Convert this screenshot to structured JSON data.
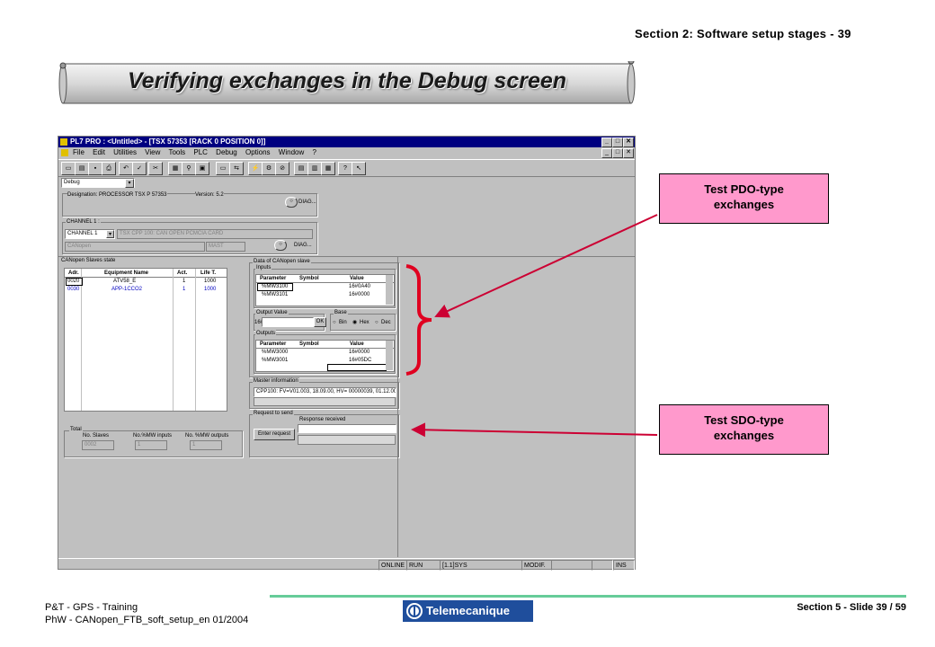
{
  "slide_header": "Section 2: Software setup stages - 39",
  "banner_title": "Verifying exchanges in the Debug screen",
  "app": {
    "title": "PL7 PRO : <Untitled> - [TSX 57353 [RACK 0     POSITION 0]]",
    "menu": [
      "File",
      "Edit",
      "Utilities",
      "View",
      "Tools",
      "PLC",
      "Debug",
      "Options",
      "Window",
      "?"
    ],
    "mode_select": "Debug",
    "designation": "Designation: PROCESSOR TSX P 57353",
    "version": "Version: 5.2",
    "diag_label": "DIAG...",
    "channel_group": "CHANNEL 1 :",
    "channel_select": "CHANNEL 1",
    "card_select": "TSX CPP 100: CAN OPEN PCMCIA CARD",
    "protocol_select": "CANopen",
    "task_select": "MAST",
    "slaves_group": "CANopen Slaves state",
    "slaves_table": {
      "headers": [
        "Adr.",
        "Equipment Name",
        "Act.",
        "Life T."
      ],
      "rows": [
        [
          "0020",
          "ATV58_E",
          "1",
          "1000"
        ],
        [
          "0030",
          "APP-1CCO2",
          "1",
          "1000"
        ]
      ]
    },
    "total_group": "Total",
    "total": {
      "labels": [
        "No. Slaves",
        "No.%MW inputs",
        "No. %MW outputs"
      ],
      "values": [
        "0002",
        "1",
        "1"
      ]
    },
    "data_group": "Data of CANopen slave",
    "inputs_group": "Inputs",
    "io_headers": [
      "Parameter",
      "Symbol",
      "Value"
    ],
    "inputs": [
      [
        "%MW3100",
        "",
        "16#0A40"
      ],
      [
        "%MW3101",
        "",
        "16#0000"
      ]
    ],
    "output_value_group": "Output Value",
    "output_prefix": "16#",
    "ok_label": "OK",
    "base_group": "Base",
    "base_options": [
      "Bin",
      "Hex",
      "Dec"
    ],
    "base_selected": "Hex",
    "outputs_group": "Outputs",
    "outputs": [
      [
        "%MW3000",
        "",
        "16#0000"
      ],
      [
        "%MW3001",
        "",
        "16#05DC"
      ]
    ],
    "master_group": "Master information",
    "master_info": "CPP100: FV=V01.003, 18.09.00, HV= 00000039, 01.12.00,",
    "request_group": "Request to send",
    "response_label": "Response received",
    "enter_request": "Enter request",
    "status_bar": [
      "ONLINE",
      "RUN",
      "[1.1]SYS",
      "MODIF.",
      "INS"
    ]
  },
  "callouts": {
    "pdo": "Test PDO-type exchanges",
    "sdo": "Test SDO-type exchanges"
  },
  "colors": {
    "callout_fill": "#ff99cc",
    "arrow": "#cc0033",
    "brace": "#e00020",
    "titlebar": "#000080",
    "footer_line": "#66cc99"
  },
  "footer": {
    "line1": "P&T - GPS - Training",
    "line2": "PhW - CANopen_FTB_soft_setup_en 01/2004",
    "logo": "Telemecanique",
    "slide": "Section 5 - Slide 39 / 59"
  }
}
